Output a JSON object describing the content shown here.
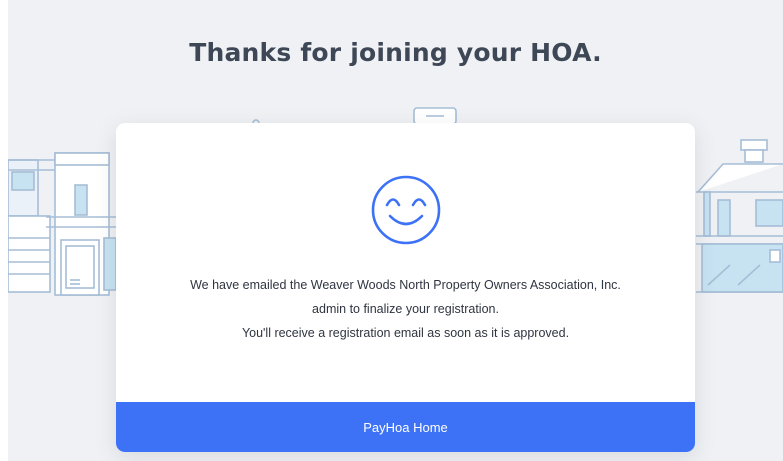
{
  "page": {
    "title": "Thanks for joining your HOA."
  },
  "modal": {
    "icon": "smiley-face-icon",
    "message_lines": [
      "We have emailed the Weaver Woods North Property Owners Association, Inc.",
      "admin to finalize your registration.",
      "You'll receive a registration email as soon as it is approved."
    ],
    "button_label": "PayHoa Home"
  },
  "colors": {
    "background": "#eff1f4",
    "title": "#3e4756",
    "accent": "#3d72f6",
    "line_art": "#a6bdd6",
    "window_fill": "#c7e3f2"
  }
}
